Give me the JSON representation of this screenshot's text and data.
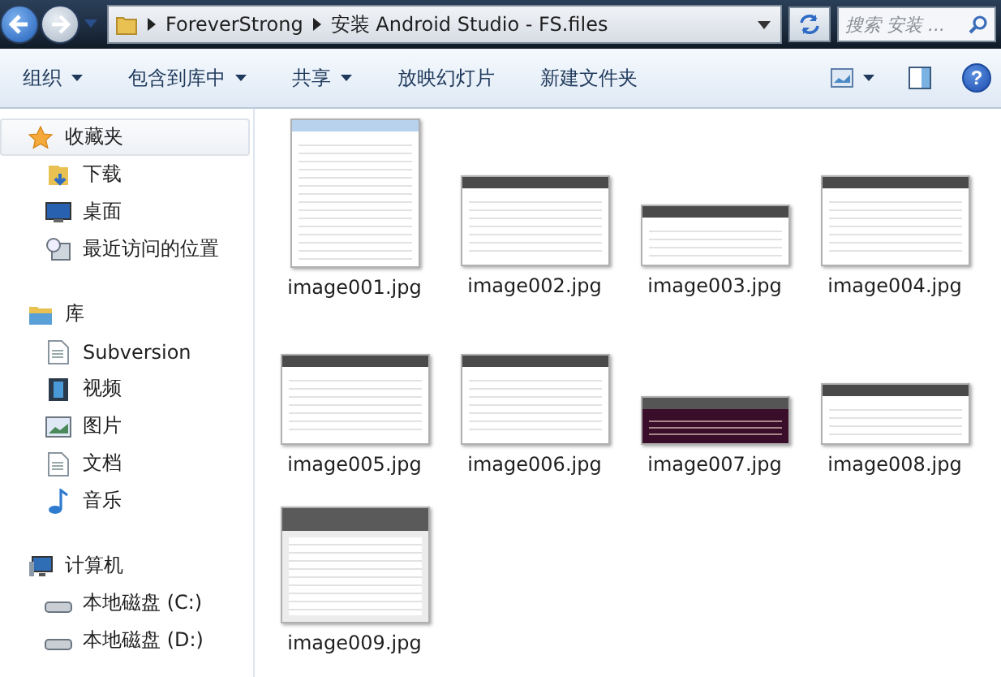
{
  "address_bar": {
    "path": [
      "ForeverStrong",
      "安装 Android Studio - FS.files"
    ]
  },
  "search": {
    "placeholder": "搜索 安装 ..."
  },
  "help_button": "?",
  "toolbar": {
    "items": [
      {
        "label": "组织",
        "dropdown": true
      },
      {
        "label": "包含到库中",
        "dropdown": true
      },
      {
        "label": "共享",
        "dropdown": true
      },
      {
        "label": "放映幻灯片",
        "dropdown": false
      },
      {
        "label": "新建文件夹",
        "dropdown": false
      }
    ]
  },
  "sidebar": {
    "groups": [
      {
        "label": "收藏夹",
        "selected": true,
        "children": [
          {
            "label": "下载",
            "selected": false
          },
          {
            "label": "桌面",
            "selected": false
          },
          {
            "label": "最近访问的位置",
            "selected": false
          }
        ]
      },
      {
        "label": "库",
        "selected": false,
        "children": [
          {
            "label": "Subversion",
            "selected": false
          },
          {
            "label": "视频",
            "selected": false
          },
          {
            "label": "图片",
            "selected": false
          },
          {
            "label": "文档",
            "selected": false
          },
          {
            "label": "音乐",
            "selected": false
          }
        ]
      },
      {
        "label": "计算机",
        "selected": false,
        "children": [
          {
            "label": "本地磁盘 (C:)",
            "selected": false
          },
          {
            "label": "本地磁盘 (D:)",
            "selected": false
          }
        ]
      }
    ]
  },
  "files": [
    {
      "name": "image001.jpg",
      "kind": "dialog"
    },
    {
      "name": "image002.jpg",
      "kind": "window"
    },
    {
      "name": "image003.jpg",
      "kind": "wide"
    },
    {
      "name": "image004.jpg",
      "kind": "window"
    },
    {
      "name": "image005.jpg",
      "kind": "window"
    },
    {
      "name": "image006.jpg",
      "kind": "window"
    },
    {
      "name": "image007.jpg",
      "kind": "terminal"
    },
    {
      "name": "image008.jpg",
      "kind": "wide"
    },
    {
      "name": "image009.jpg",
      "kind": "setup"
    }
  ]
}
